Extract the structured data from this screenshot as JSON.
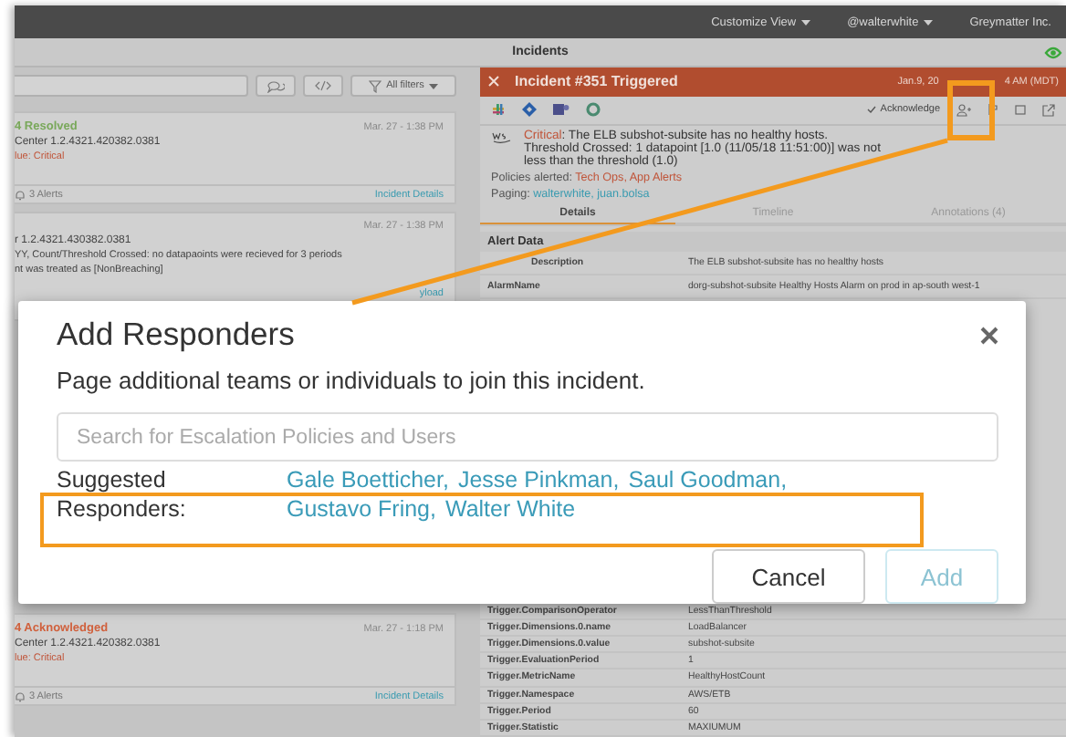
{
  "top_bar": {
    "menus": [
      {
        "label": "Customize View"
      },
      {
        "label": "@walterwhite"
      }
    ],
    "org": "Greymatter Inc."
  },
  "page_title": "Incidents",
  "incident_list": {
    "filter_label": "All filters",
    "cards": [
      {
        "kind": "resolved",
        "status": "4 Resolved",
        "time": "Mar. 27 - 1:38 PM",
        "source": "Center 1.2.4321.420382.0381",
        "severity": "lue: Critical",
        "alerts": "3 Alerts",
        "link": "Incident Details"
      },
      {
        "kind": "message",
        "time": "Mar. 27 - 1:38 PM",
        "source": "r 1.2.4321.430382.0381",
        "lines": [
          "YY, Count/Threshold Crossed: no datapaoints were recieved for 3 periods",
          "nt was treated as [NonBreaching]"
        ],
        "link": "yload"
      },
      {
        "kind": "acknowledged",
        "status": "4 Acknowledged",
        "time": "Mar. 27 - 1:18 PM",
        "source": "Center 1.2.4321.420382.0381",
        "severity": "lue: Critical",
        "alerts": "3 Alerts",
        "link": "Incident Details"
      }
    ]
  },
  "incident": {
    "title": "Incident #351 Triggered",
    "date_parts": [
      "Jan.9, 20",
      "4 AM (MDT)"
    ],
    "acknowledge": "Acknowledge",
    "severity": "Critical",
    "message": ": The ELB subshot-subsite has no healthy hosts. Threshold Crossed: 1 datapoint [1.0 (11/05/18 11:51:00)] was not less than the threshold (1.0)",
    "policies_label": "Policies alerted:",
    "policies": "Tech Ops, App Alerts",
    "paging_label": "Paging:",
    "paging": "walterwhite,  juan.bolsa",
    "tabs": [
      {
        "label": "Details",
        "selected": true
      },
      {
        "label": "Timeline",
        "selected": false
      },
      {
        "label": "Annotations (4)",
        "selected": false
      }
    ],
    "section": "Alert Data",
    "rows_top": [
      {
        "key": "Description",
        "value": "The ELB subshot-subsite has no healthy hosts"
      },
      {
        "key": "AlarmName",
        "value": "dorg-subshot-subsite Healthy Hosts Alarm on prod in ap-south west-1"
      }
    ],
    "rows_bottom": [
      {
        "key": "Trigger.ComparisonOperator",
        "value": "LessThanThreshold"
      },
      {
        "key": "Trigger.Dimensions.0.name",
        "value": "LoadBalancer"
      },
      {
        "key": "Trigger.Dimensions.0.value",
        "value": "subshot-subsite"
      },
      {
        "key": "Trigger.EvaluationPeriod",
        "value": "1"
      },
      {
        "key": "Trigger.MetricName",
        "value": "HealthyHostCount"
      },
      {
        "key": "Trigger.Namespace",
        "value": "AWS/ETB"
      },
      {
        "key": "Trigger.Period",
        "value": "60"
      },
      {
        "key": "Trigger.Statistic",
        "value": "MAXIUMUM"
      }
    ]
  },
  "modal": {
    "title": "Add Responders",
    "description": "Page additional teams or individuals to join this incident.",
    "search": {
      "placeholder": "Search for Escalation Policies and Users"
    },
    "suggested_label": "Suggested Responders:",
    "suggested": [
      "Gale Boetticher,",
      "Jesse Pinkman,",
      "Saul Goodman,",
      "Gustavo Fring,",
      "Walter White"
    ],
    "buttons": [
      {
        "label": "Cancel",
        "disabled": false
      },
      {
        "label": "Add",
        "disabled": true
      }
    ]
  }
}
